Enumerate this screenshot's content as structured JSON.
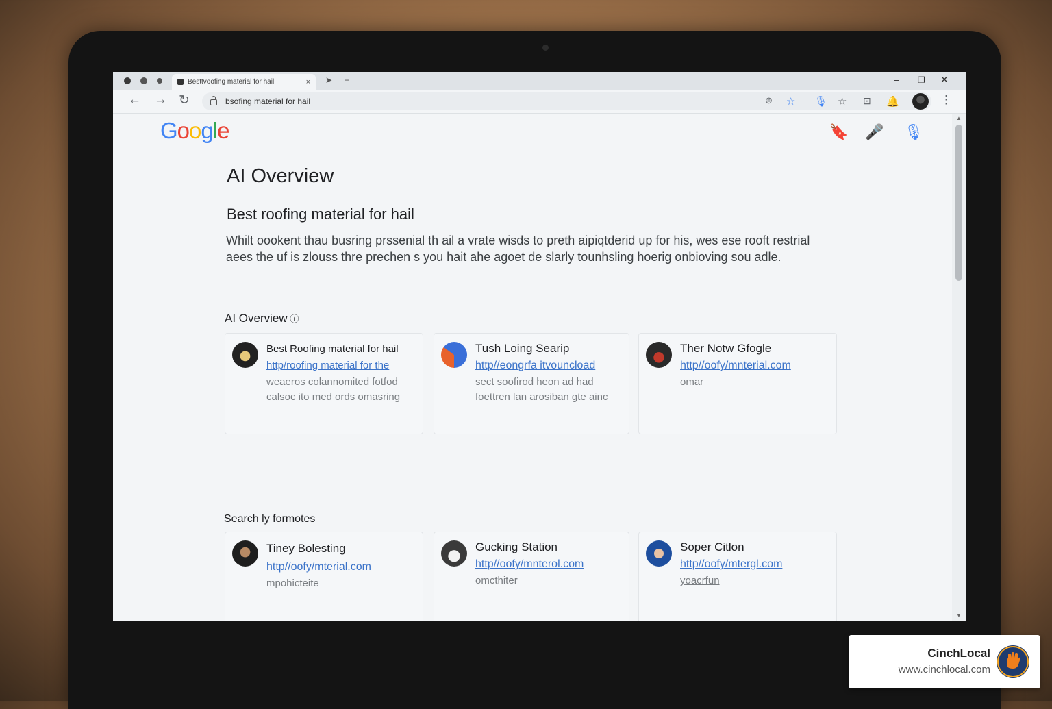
{
  "browser": {
    "tab_title": "Besttvoofing material for hail",
    "tab_close": "×",
    "address": "bsofing material for hail",
    "window": {
      "minimize": "–",
      "restore": "❐",
      "close": "✕"
    }
  },
  "page": {
    "logo": [
      "G",
      "o",
      "o",
      "g",
      "l",
      "e"
    ],
    "logo_colors": [
      "#4285F4",
      "#EA4335",
      "#FBBC05",
      "#4285F4",
      "#34A853",
      "#EA4335"
    ],
    "ai_title": "AI Overview",
    "query": "Best roofing material for hail",
    "summary": "Whilt oookent thau busring prssenial th ail a vrate wisds to preth aipiqtderid up for his, wes ese rooft restrial aees the uf is zlouss thre prechen  s you hait ahe agoet de slarly tounhsling hoerig onbioving sou adle.",
    "section1": "AI Overview",
    "section2": "Search ly formotes",
    "cards_row1": [
      {
        "title": "Best Roofing material for hail",
        "url": "http/roofing material for the",
        "desc": "weaeros colannomited fotfod calsoc ito med ords omasring"
      },
      {
        "title": "Tush Loing Searip",
        "url": "http//eongrfa itvouncload",
        "desc": "sect soofirod heon ad had foettren lan arosiban gte ainc"
      },
      {
        "title": "Ther Notw Gfogle",
        "url": "http//oofy/mnterial.com",
        "desc": "omar"
      }
    ],
    "cards_row2": [
      {
        "title": "Tiney Bolesting",
        "url": "http//oofy/mterial.com",
        "desc": "mpohicteite"
      },
      {
        "title": "Gucking Station",
        "url": "http//oofy/mnterol.com",
        "desc": "omcthiter"
      },
      {
        "title": "Soper Citlon",
        "url": "http//oofy/mtergl.com",
        "desc": "yoacrfun"
      }
    ]
  },
  "brand": {
    "name": "CinchLocal",
    "url": "www.cinchlocal.com"
  },
  "colors": {
    "link": "#3b73c9",
    "accent_blue": "#4285F4",
    "accent_red": "#EA4335"
  }
}
